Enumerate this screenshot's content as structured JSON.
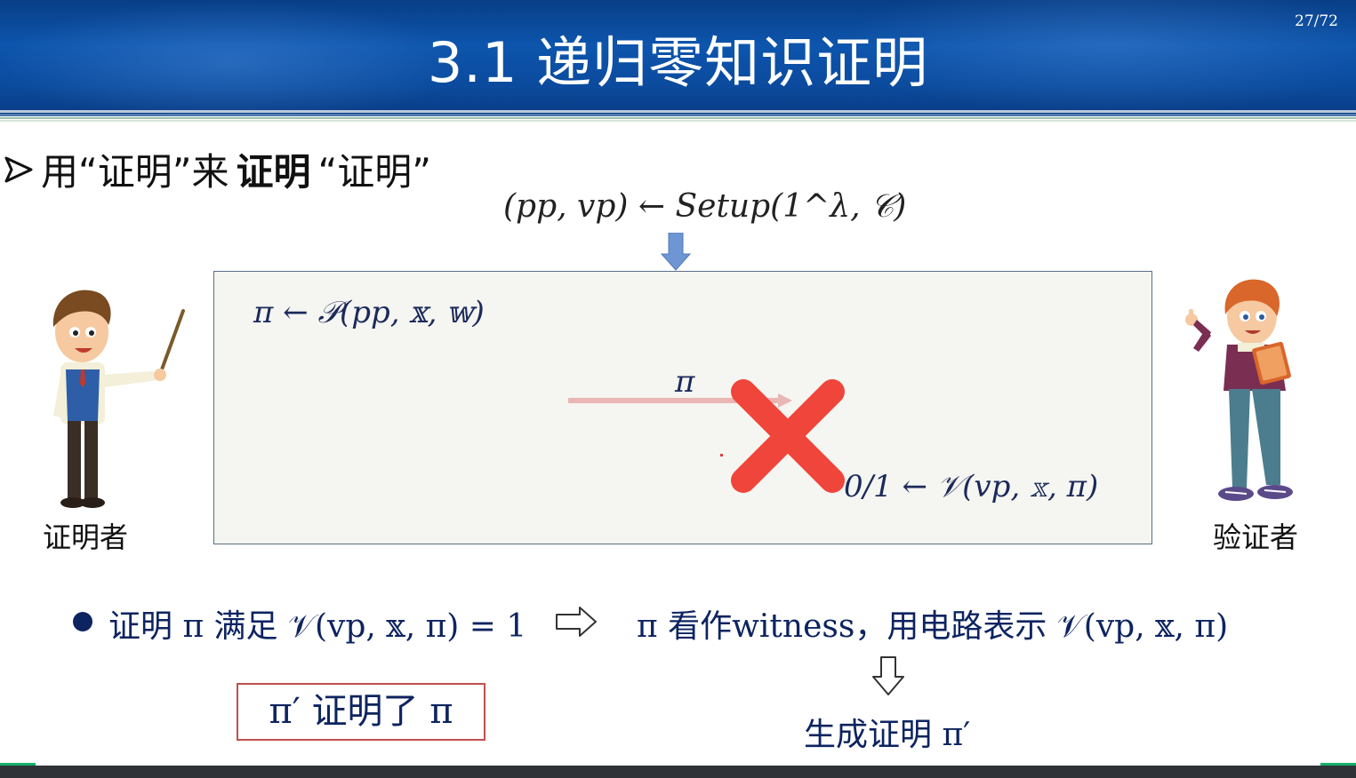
{
  "header": {
    "title": "3.1 递归零知识证明",
    "page_number": "27/72"
  },
  "heading": {
    "part1": "用“证明”来",
    "part2": "证明",
    "part3": "“证明”"
  },
  "setup": {
    "formula": "(pp, vp) ← Setup(1^λ, 𝒞)"
  },
  "protocol": {
    "prover_formula": "π ← 𝒫(pp, 𝕩, 𝕨)",
    "message": "π",
    "verifier_formula": "0/1 ← 𝒱(vp, 𝕩, π)"
  },
  "labels": {
    "prover": "证明者",
    "verifier": "验证者"
  },
  "bullet": {
    "left_text": "证明 π 满足 𝒱(vp, 𝕩, π) = 1",
    "right_text": "π 看作witness，用电路表示 𝒱(vp, 𝕩, π)",
    "generate": "生成证明 π′",
    "boxed": "π′ 证明了 π"
  },
  "colors": {
    "header_blue": "#0d55ad",
    "cross_red": "#f0453a",
    "text_navy": "#0d2460",
    "box_border_red": "#c0504d"
  }
}
